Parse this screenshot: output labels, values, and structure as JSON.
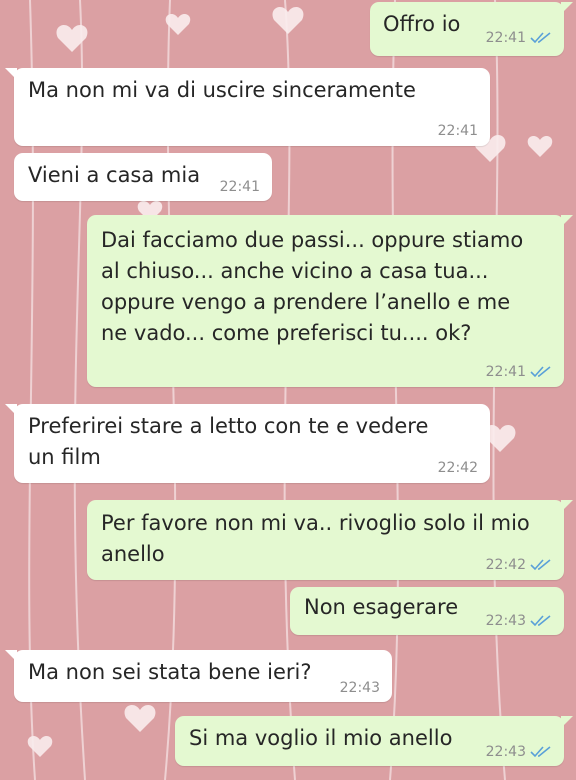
{
  "colors": {
    "background": "#dba0a3",
    "incoming_bubble": "#ffffff",
    "outgoing_bubble": "#e4f9d1",
    "read_ticks": "#5aa0d8"
  },
  "messages": [
    {
      "direction": "outgoing",
      "text": "Offro io",
      "time": "22:41",
      "status": "read"
    },
    {
      "direction": "incoming",
      "text": "Ma non mi va di uscire sinceramente",
      "time": "22:41"
    },
    {
      "direction": "incoming",
      "text": "Vieni a casa mia",
      "time": "22:41"
    },
    {
      "direction": "outgoing",
      "text": "Dai facciamo due passi... oppure stiamo\nal chiuso... anche vicino a casa tua...\noppure vengo a prendere l’anello e me\nne vado... come preferisci tu.... ok?",
      "time": "22:41",
      "status": "read"
    },
    {
      "direction": "incoming",
      "text": "Preferirei stare a letto con te e vedere\nun film",
      "time": "22:42"
    },
    {
      "direction": "outgoing",
      "text": "Per favore non mi va.. rivoglio solo il mio\nanello",
      "time": "22:42",
      "status": "read"
    },
    {
      "direction": "outgoing",
      "text": "Non esagerare",
      "time": "22:43",
      "status": "read"
    },
    {
      "direction": "incoming",
      "text": "Ma non sei stata bene ieri?",
      "time": "22:43"
    },
    {
      "direction": "outgoing",
      "text": "Si ma voglio il mio anello",
      "time": "22:43",
      "status": "read"
    }
  ]
}
